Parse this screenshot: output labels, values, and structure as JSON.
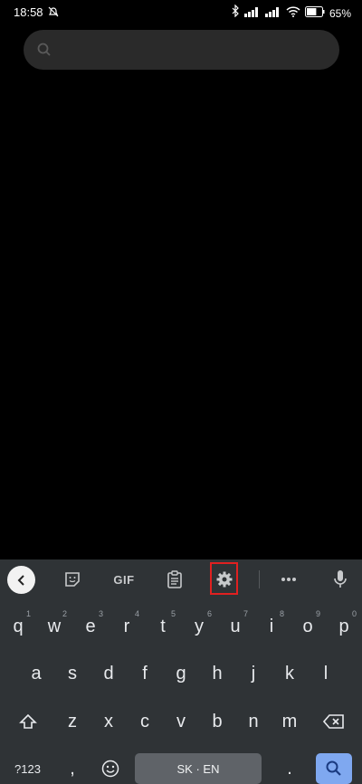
{
  "status_bar": {
    "time": "18:58",
    "battery_percent": "65%",
    "battery_level": 0.65
  },
  "search": {
    "placeholder": ""
  },
  "keyboard": {
    "toolbar": {
      "icons": [
        "back-arrow-icon",
        "sticker-icon",
        "gif-icon",
        "clipboard-icon",
        "gear-icon",
        "more-icon",
        "microphone-icon"
      ],
      "gif_label": "GIF",
      "highlight_color": "#e02020"
    },
    "row1": [
      {
        "key": "q",
        "hint": "1"
      },
      {
        "key": "w",
        "hint": "2"
      },
      {
        "key": "e",
        "hint": "3"
      },
      {
        "key": "r",
        "hint": "4"
      },
      {
        "key": "t",
        "hint": "5"
      },
      {
        "key": "y",
        "hint": "6"
      },
      {
        "key": "u",
        "hint": "7"
      },
      {
        "key": "i",
        "hint": "8"
      },
      {
        "key": "o",
        "hint": "9"
      },
      {
        "key": "p",
        "hint": "0"
      }
    ],
    "row2": [
      "a",
      "s",
      "d",
      "f",
      "g",
      "h",
      "j",
      "k",
      "l"
    ],
    "row3": [
      "z",
      "x",
      "c",
      "v",
      "b",
      "n",
      "m"
    ],
    "row4": {
      "symbols": "?123",
      "comma": ",",
      "space_label": "SK · EN",
      "period": "."
    },
    "colors": {
      "background": "#2f3336",
      "space_key": "#5f6368",
      "enter_key": "#7fa8f0"
    }
  }
}
